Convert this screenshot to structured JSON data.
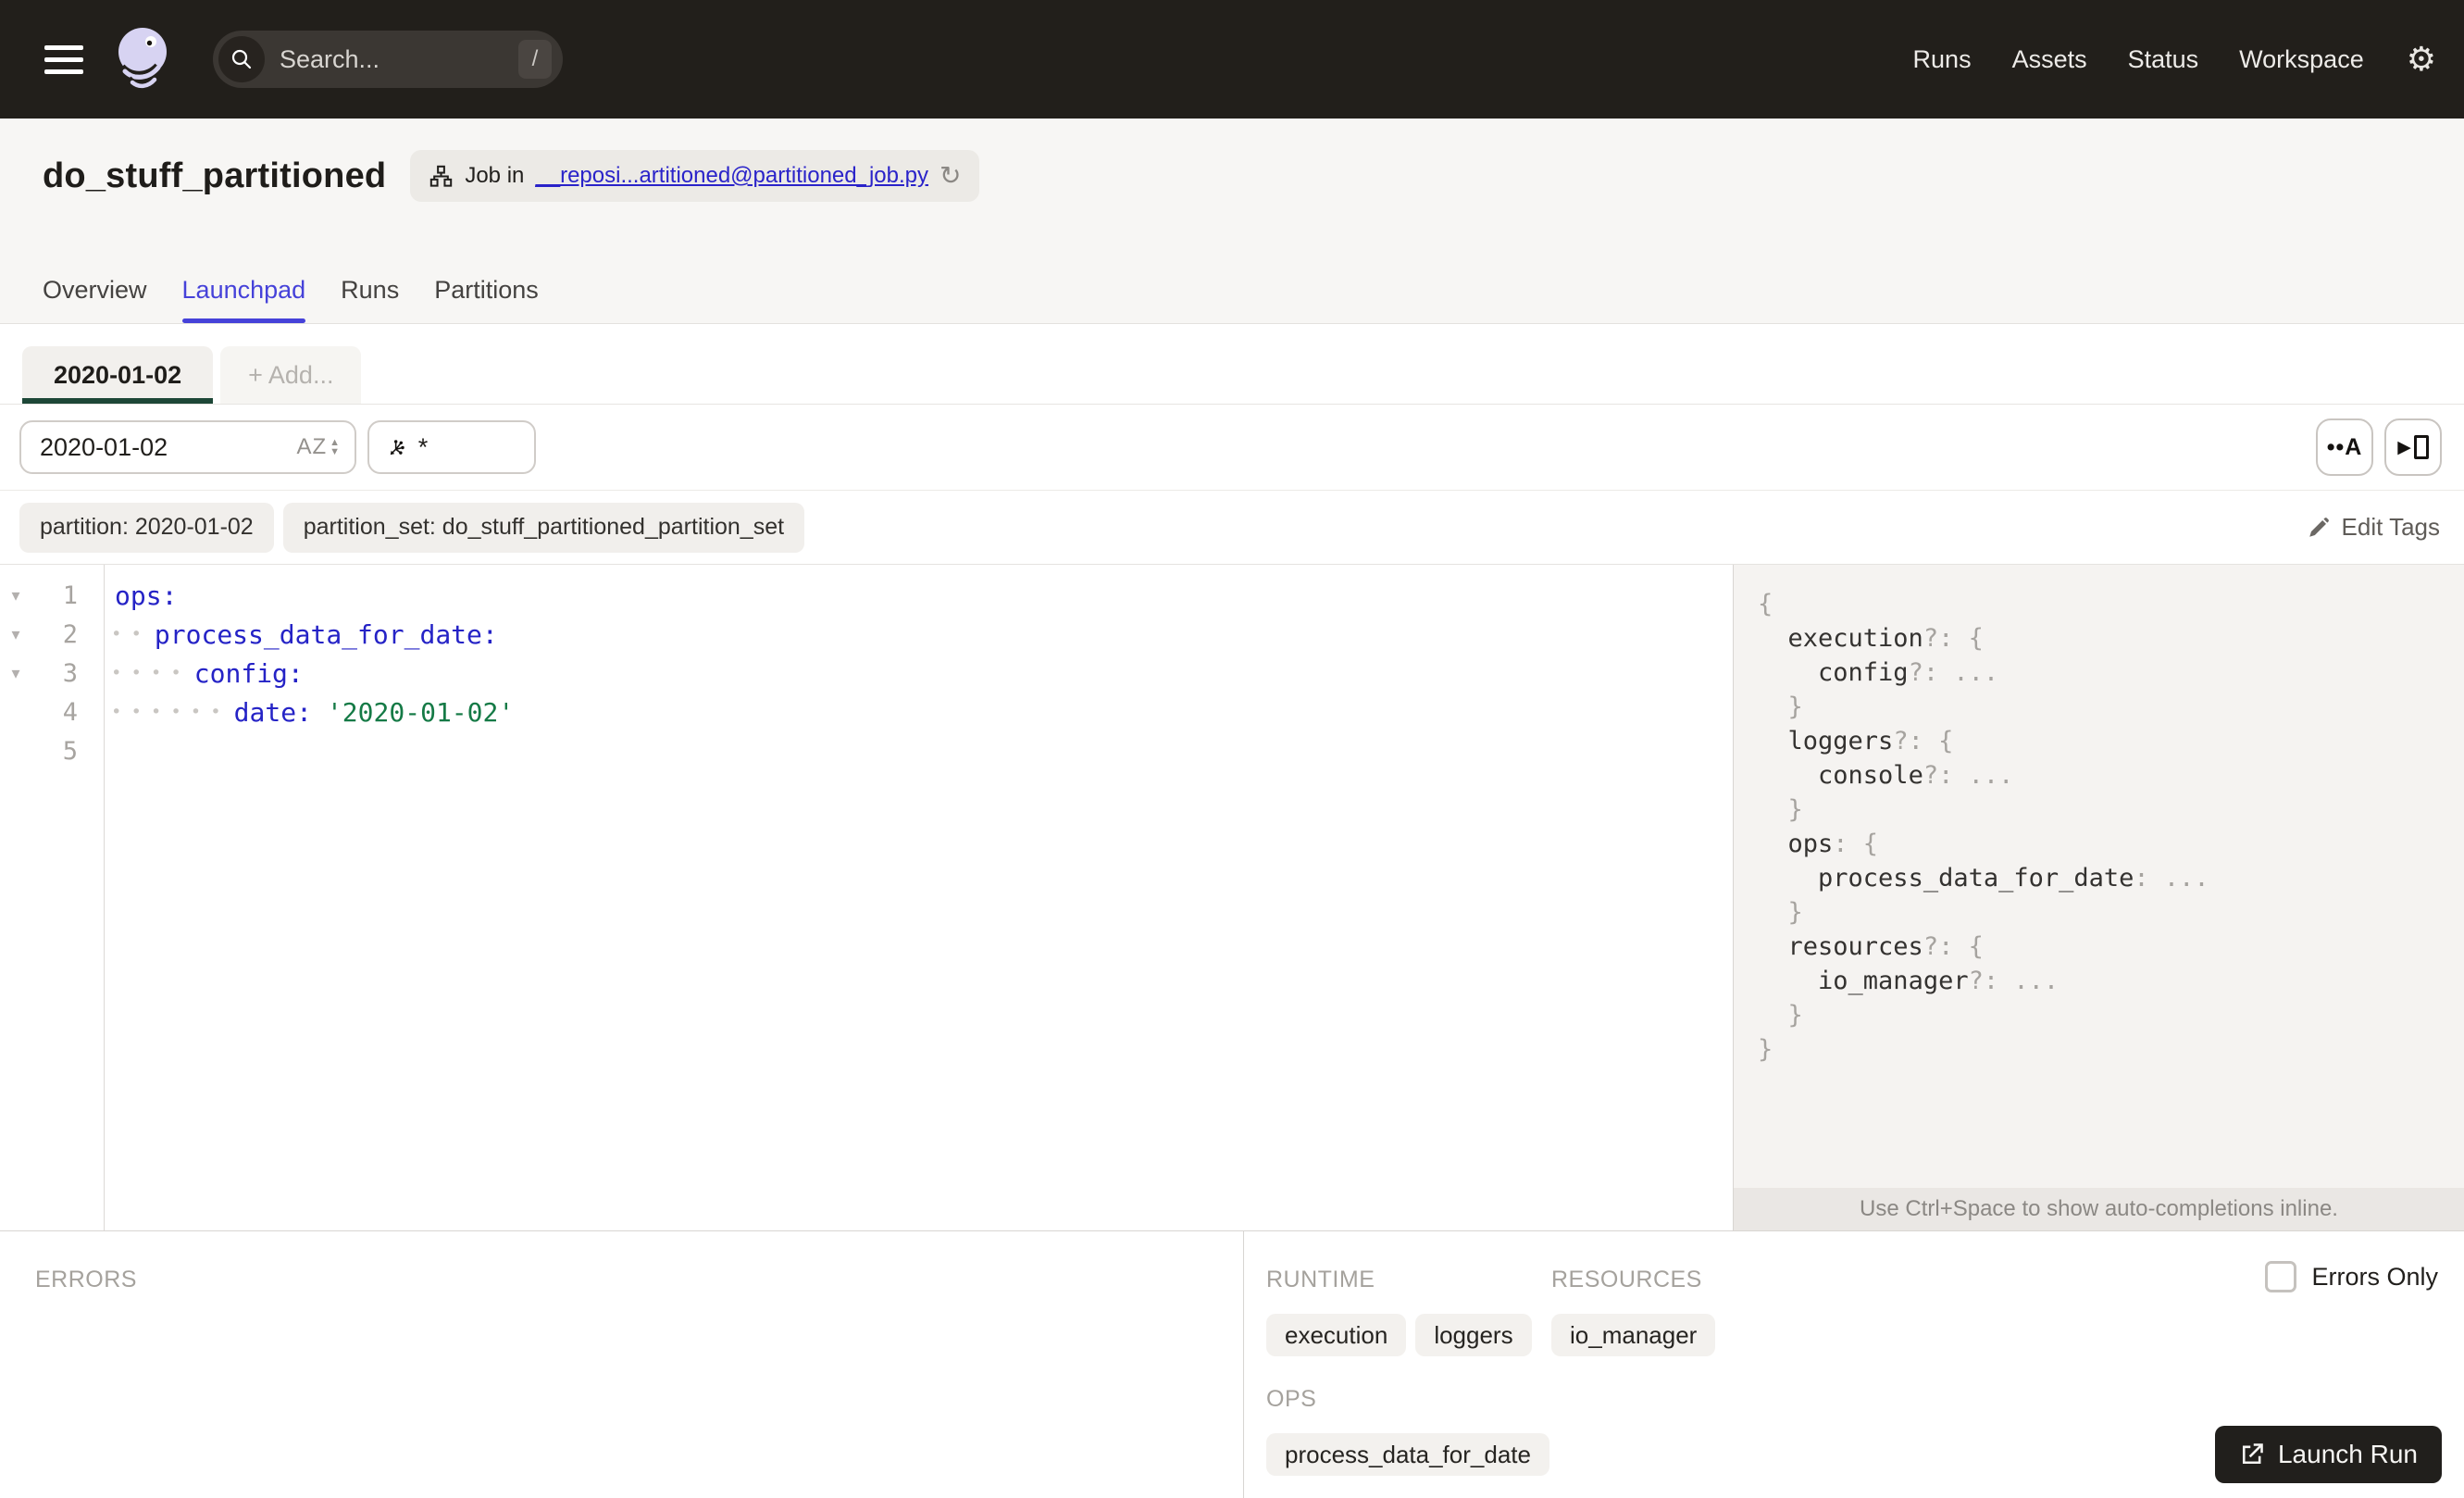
{
  "topbar": {
    "search": {
      "placeholder": "Search...",
      "shortcut": "/"
    },
    "nav_items": [
      "Runs",
      "Assets",
      "Status",
      "Workspace"
    ]
  },
  "header": {
    "title": "do_stuff_partitioned",
    "job_badge": {
      "prefix": "Job in",
      "link_text": "__reposi...artitioned@partitioned_job.py"
    }
  },
  "tabs": {
    "items": [
      "Overview",
      "Launchpad",
      "Runs",
      "Partitions"
    ],
    "active": "Launchpad"
  },
  "launchpad": {
    "partition_tab": "2020-01-02",
    "add_tab": "+ Add...",
    "partition_value": "2020-01-02",
    "scaffold_value": "*",
    "tags": [
      "partition: 2020-01-02",
      "partition_set: do_stuff_partitioned_partition_set"
    ],
    "edit_tags": "Edit Tags"
  },
  "editor": {
    "lines": [
      {
        "num": "1",
        "fold": "▾",
        "dots": "",
        "key": "ops:",
        "value": ""
      },
      {
        "num": "2",
        "fold": "▾",
        "dots": "••",
        "key": "process_data_for_date:",
        "value": ""
      },
      {
        "num": "3",
        "fold": "▾",
        "dots": "••••",
        "key": "config:",
        "value": ""
      },
      {
        "num": "4",
        "fold": "",
        "dots": "••••••",
        "key": "date:",
        "value": "'2020-01-02'"
      },
      {
        "num": "5",
        "fold": "",
        "dots": "",
        "key": "",
        "value": ""
      }
    ]
  },
  "schema": {
    "lines": [
      {
        "pad": "",
        "key": "",
        "rest": "{"
      },
      {
        "pad": "  ",
        "key": "execution",
        "rest": "?: {"
      },
      {
        "pad": "    ",
        "key": "config",
        "rest": "?: ..."
      },
      {
        "pad": "  ",
        "key": "",
        "rest": "}"
      },
      {
        "pad": "  ",
        "key": "loggers",
        "rest": "?: {"
      },
      {
        "pad": "    ",
        "key": "console",
        "rest": "?: ..."
      },
      {
        "pad": "  ",
        "key": "",
        "rest": "}"
      },
      {
        "pad": "  ",
        "key": "ops",
        "rest": ": {"
      },
      {
        "pad": "    ",
        "key": "process_data_for_date",
        "rest": ": ..."
      },
      {
        "pad": "  ",
        "key": "",
        "rest": "}"
      },
      {
        "pad": "  ",
        "key": "resources",
        "rest": "?: {"
      },
      {
        "pad": "    ",
        "key": "io_manager",
        "rest": "?: ..."
      },
      {
        "pad": "  ",
        "key": "",
        "rest": "}"
      },
      {
        "pad": "",
        "key": "",
        "rest": "}"
      }
    ],
    "hint": "Use Ctrl+Space to show auto-completions inline."
  },
  "bottom": {
    "errors_heading": "ERRORS",
    "runtime_heading": "RUNTIME",
    "runtime_chips": [
      "execution",
      "loggers"
    ],
    "resources_heading": "RESOURCES",
    "resources_chips": [
      "io_manager"
    ],
    "ops_heading": "OPS",
    "ops_chips": [
      "process_data_for_date"
    ],
    "errors_only_label": "Errors Only",
    "errors_only_checked": false,
    "launch_button": "Launch Run"
  },
  "icons": {
    "gear": "⚙",
    "refresh": "↻",
    "sort_az": "AZ",
    "autocomplete_dots": "••A",
    "play": "▶"
  },
  "colors": {
    "topbar_bg": "#221f1b",
    "accent_blue": "#4642d9",
    "link_blue": "#2a23c9",
    "code_key": "#2523c6",
    "code_string": "#157a46",
    "partition_tab_underline": "#1d4737",
    "launch_button_bg": "#211f1c"
  }
}
